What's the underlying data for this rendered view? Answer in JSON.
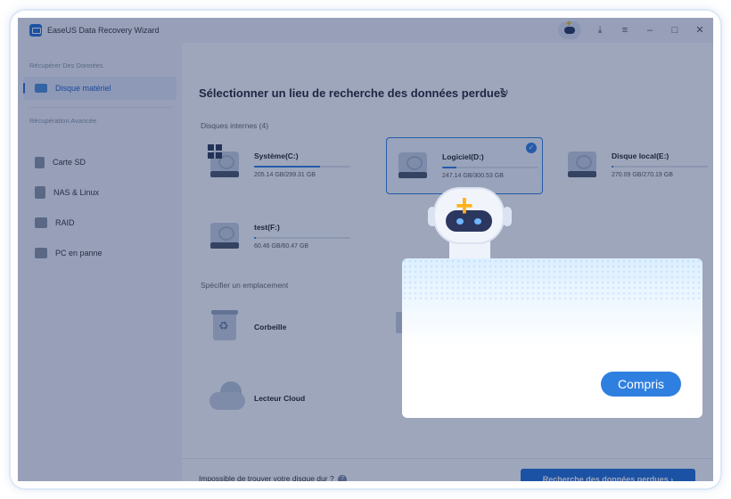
{
  "window": {
    "title": "EaseUS Data Recovery Wizard"
  },
  "sidebar": {
    "group_recover": "Récupérer Des Données",
    "group_advanced": "Récupération Avancée",
    "items": [
      {
        "label": "Disque matériel",
        "active": true
      },
      {
        "label": "Carte SD"
      },
      {
        "label": "NAS & Linux"
      },
      {
        "label": "RAID"
      },
      {
        "label": "PC en panne"
      }
    ]
  },
  "main": {
    "title": "Sélectionner un lieu de recherche des données perdues",
    "internal_disks_label": "Disques internes (4)",
    "disks": [
      {
        "name": "Système(C:)",
        "size": "205.14 GB/299.31 GB",
        "used_fraction": 0.685
      },
      {
        "name": "Logiciel(D:)",
        "size": "247.14 GB/300.53 GB",
        "used_fraction": 0.15,
        "selected": true
      },
      {
        "name": "Disque local(E:)",
        "size": "270.09 GB/270.19 GB",
        "used_fraction": 0.02
      },
      {
        "name": "test(F:)",
        "size": "60.46 GB/60.47 GB",
        "used_fraction": 0.02
      }
    ],
    "location_label": "Spécifier un emplacement",
    "locations": [
      {
        "name": "Corbeille"
      },
      {
        "name": "Lecteur Cloud"
      }
    ],
    "cant_find": "Impossible de trouver votre disque dur ?",
    "search_button": "Recherche des données perdues ›"
  },
  "tooltip": {
    "button": "Compris"
  },
  "colors": {
    "accent": "#2f7fe0",
    "overlay": "rgba(24,42,92,0.42)"
  }
}
